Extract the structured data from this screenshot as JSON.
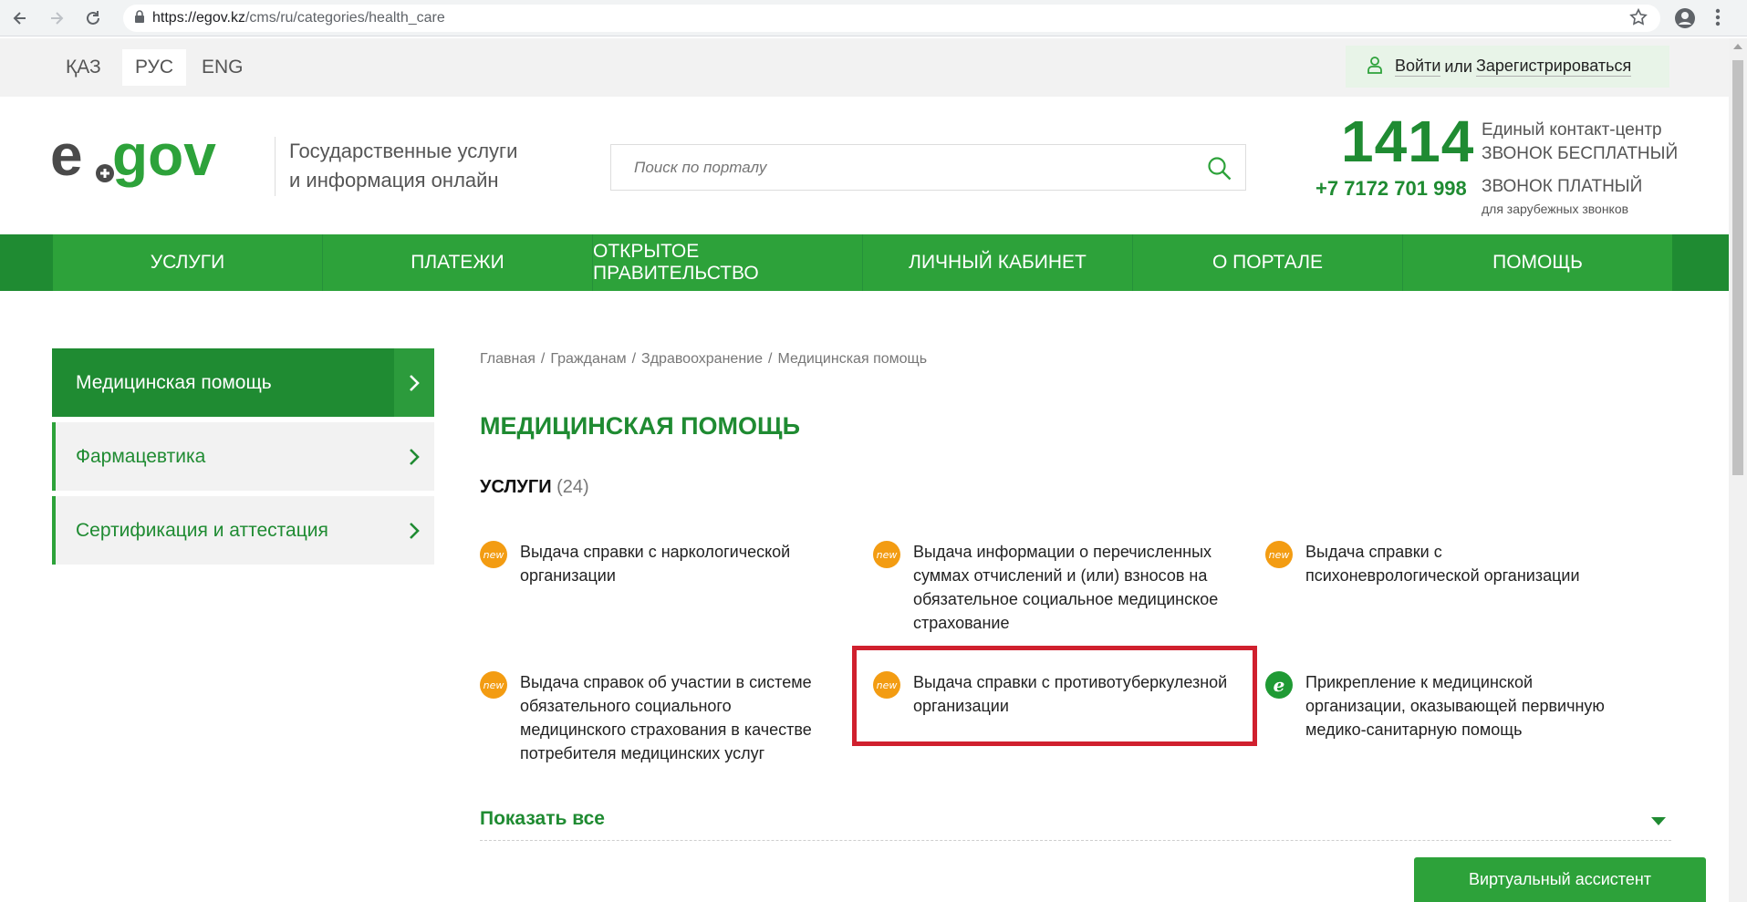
{
  "browser": {
    "url_host": "https://egov.kz",
    "url_path": "/cms/ru/categories/health_care"
  },
  "languages": [
    {
      "label": "ҚАЗ",
      "active": false
    },
    {
      "label": "РУС",
      "active": true
    },
    {
      "label": "ENG",
      "active": false
    }
  ],
  "auth": {
    "login": "Войти",
    "or": "или",
    "register": "Зарегистрироваться"
  },
  "header": {
    "tagline_line1": "Государственные услуги",
    "tagline_line2": "и информация онлайн",
    "search_placeholder": "Поиск по порталу",
    "phone_main": "1414",
    "phone_main_desc1": "Единый контакт-центр",
    "phone_main_desc2": "ЗВОНОК БЕСПЛАТНЫЙ",
    "phone_alt": "+7 7172 701 998",
    "phone_alt_desc": "ЗВОНОК ПЛАТНЫЙ",
    "phone_alt_note": "для зарубежных звонков"
  },
  "nav": [
    "УСЛУГИ",
    "ПЛАТЕЖИ",
    "ОТКРЫТОЕ ПРАВИТЕЛЬСТВО",
    "ЛИЧНЫЙ КАБИНЕТ",
    "О ПОРТАЛЕ",
    "ПОМОЩЬ"
  ],
  "sidebar": {
    "items": [
      {
        "label": "Медицинская помощь",
        "active": true
      },
      {
        "label": "Фармацевтика",
        "active": false
      },
      {
        "label": "Сертификация и аттестация",
        "active": false
      }
    ]
  },
  "breadcrumb": [
    "Главная",
    "Гражданам",
    "Здравоохранение",
    "Медицинская помощь"
  ],
  "page_title": "МЕДИЦИНСКАЯ ПОМОЩЬ",
  "services": {
    "heading": "УСЛУГИ",
    "count": "(24)",
    "items": [
      {
        "badge": "new",
        "lines": [
          "Выдача справки с наркологической",
          "организации"
        ]
      },
      {
        "badge": "new",
        "lines": [
          "Выдача информации о перечисленных",
          "суммах отчислений и (или) взносов на",
          "обязательное социальное медицинское",
          "страхование"
        ]
      },
      {
        "badge": "new",
        "lines": [
          "Выдача справки с",
          "психоневрологической организации"
        ]
      },
      {
        "badge": "new",
        "lines": [
          "Выдача справок об участии в системе",
          "обязательного социального",
          "медицинского страхования в качестве",
          "потребителя медицинских услуг"
        ]
      },
      {
        "badge": "new",
        "lines": [
          "Выдача справки с противотуберкулезной",
          "организации"
        ],
        "highlighted": true
      },
      {
        "badge": "e",
        "lines": [
          "Прикрепление к медицинской",
          "организации, оказывающей первичную",
          "медико-санитарную помощь"
        ]
      }
    ],
    "badge_new_text": "new",
    "badge_e_text": "e"
  },
  "show_all": "Показать все",
  "assistant": "Виртуальный ассистент",
  "colors": {
    "brand_green": "#1f8b32",
    "nav_green": "#2da23a",
    "badge_orange": "#f39c12",
    "highlight_red": "#d0202e"
  }
}
